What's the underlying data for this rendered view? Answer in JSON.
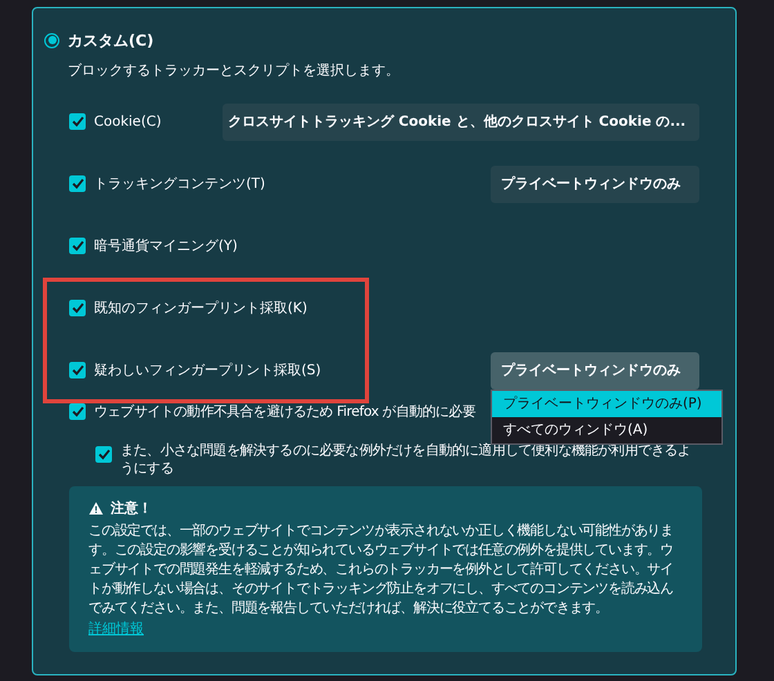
{
  "custom": {
    "label": "カスタム(C)",
    "selected": true,
    "description": "ブロックするトラッカーとスクリプトを選択します。"
  },
  "options": [
    {
      "label": "Cookie(C)",
      "checked": true,
      "highlighted": false,
      "dropdown": {
        "value": "クロスサイトトラッキング Cookie と、他のクロスサイト Cookie の...",
        "open": false,
        "wide": true
      }
    },
    {
      "label": "トラッキングコンテンツ(T)",
      "checked": true,
      "highlighted": false,
      "dropdown": {
        "value": "プライベートウィンドウのみ",
        "open": false,
        "wide": false
      }
    },
    {
      "label": "暗号通貨マイニング(Y)",
      "checked": true,
      "highlighted": false
    },
    {
      "label": "既知のフィンガープリント採取(K)",
      "checked": true,
      "highlighted": true
    },
    {
      "label": "疑わしいフィンガープリント採取(S)",
      "checked": true,
      "highlighted": true,
      "dropdown": {
        "value": "プライベートウィンドウのみ",
        "open": true,
        "wide": false,
        "menu": [
          {
            "label": "プライベートウィンドウのみ(P)",
            "selected": true
          },
          {
            "label": "すべてのウィンドウ(A)",
            "selected": false
          }
        ]
      }
    },
    {
      "label": "ウェブサイトの動作不具合を避けるため Firefox が自動的に必要",
      "checked": true,
      "highlighted": false,
      "children": [
        {
          "label": "また、小さな問題を解決するのに必要な例外だけを自動的に適用して便利な機能が利用できるようにする",
          "checked": true
        }
      ]
    }
  ],
  "warning": {
    "title": "注意！",
    "text": "この設定では、一部のウェブサイトでコンテンツが表示されないか正しく機能しない可能性があります。この設定の影響を受けることが知られているウェブサイトでは任意の例外を提供しています。ウェブサイトでの問題発生を軽減するため、これらのトラッカーを例外として許可してください。サイトが動作しない場合は、そのサイトでトラッキング防止をオフにし、すべてのコンテンツを読み込んでみてください。また、問題を報告していただければ、解決に役立てることができます。",
    "link": "詳細情報"
  }
}
